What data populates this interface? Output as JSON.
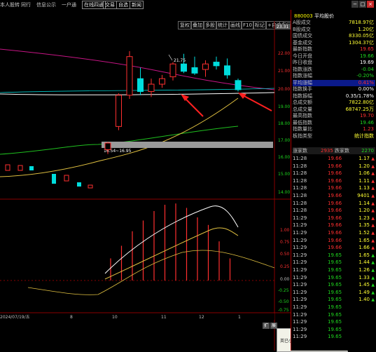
{
  "menu": {
    "items": [
      "本人股转",
      "同行",
      "信息公示",
      "一户通"
    ],
    "buttons": [
      "在线四通",
      "交易",
      "自选",
      "新闻"
    ]
  },
  "window_controls": [
    "−",
    "□",
    "×"
  ],
  "toolbar": {
    "buttons": [
      "复权",
      "叠加",
      "多股",
      "统计",
      "画线",
      "F10",
      "标记",
      "+自选",
      "返回"
    ]
  },
  "chart": {
    "ref_price_tag": "23.31",
    "high_marker": "21.75",
    "low_marker": "16.54~16.95",
    "price_axis": [
      "22.00",
      "21.00",
      "20.00",
      "19.00",
      "18.00",
      "17.00",
      "16.00",
      "15.00",
      "14.00"
    ],
    "indicator_axis": [
      "1.00",
      "0.75",
      "0.50",
      "0.25",
      "0.00",
      "-0.25",
      "-0.50",
      "-0.75"
    ],
    "date_label": "2024/07/19/五",
    "x_labels": [
      "8",
      "10",
      "11",
      "12",
      "1"
    ],
    "bottom_tabs": [
      "扩",
      "展"
    ],
    "popup_text": "英已小股都在转移：个半都转了"
  },
  "chart_data": {
    "type": "candlestick",
    "candles": [
      {
        "o": 16.54,
        "h": 16.95,
        "l": 16.3,
        "c": 16.9,
        "up": true
      },
      {
        "o": 17.8,
        "h": 19.6,
        "l": 17.6,
        "c": 19.5,
        "up": true
      },
      {
        "o": 19.5,
        "h": 21.9,
        "l": 19.3,
        "c": 21.6,
        "up": true
      },
      {
        "o": 20.4,
        "h": 21.0,
        "l": 19.5,
        "c": 19.7,
        "up": false
      },
      {
        "o": 19.7,
        "h": 20.4,
        "l": 19.4,
        "c": 20.1,
        "up": true
      },
      {
        "o": 20.1,
        "h": 20.6,
        "l": 19.9,
        "c": 20.4,
        "up": true
      },
      {
        "o": 20.5,
        "h": 21.3,
        "l": 20.3,
        "c": 21.2,
        "up": true
      },
      {
        "o": 21.2,
        "h": 21.75,
        "l": 20.7,
        "c": 20.8,
        "up": false
      },
      {
        "o": 21.0,
        "h": 21.6,
        "l": 20.6,
        "c": 20.7,
        "up": false
      },
      {
        "o": 20.9,
        "h": 21.4,
        "l": 20.5,
        "c": 21.2,
        "up": true
      },
      {
        "o": 21.3,
        "h": 21.6,
        "l": 20.9,
        "c": 21.1,
        "up": false
      },
      {
        "o": 21.1,
        "h": 21.5,
        "l": 20.4,
        "c": 20.6,
        "up": false
      },
      {
        "o": 20.3,
        "h": 20.4,
        "l": 19.7,
        "c": 19.8,
        "up": false
      }
    ],
    "histogram": [
      0.35,
      0.55,
      0.78,
      0.95,
      1.1,
      1.2,
      1.22,
      1.15,
      1.0,
      0.88,
      0.62,
      0.35
    ],
    "ylim": [
      14,
      23
    ],
    "indicator_ylim": [
      -0.75,
      1.25
    ]
  },
  "quote": {
    "code": "880003",
    "name": "平均股价",
    "rows": [
      {
        "label": "A股成交",
        "value": "7818.97亿",
        "color": "#ffff33"
      },
      {
        "label": "B股成交",
        "value": "1.20亿",
        "color": "#ffff33"
      },
      {
        "label": "国债成交",
        "value": "8330.05亿",
        "color": "#ffff33"
      },
      {
        "label": "基金成交",
        "value": "1304.37亿",
        "color": "#ffff33"
      },
      {
        "label": "最新指数",
        "value": "19.65",
        "color": "#ff3030"
      },
      {
        "label": "今日开盘",
        "value": "19.66",
        "color": "#1fd81f"
      },
      {
        "label": "昨日收盘",
        "value": "19.69",
        "color": "#ffffff"
      },
      {
        "label": "指数涨跌",
        "value": "-0.04",
        "color": "#1fd81f"
      },
      {
        "label": "指数涨幅",
        "value": "-0.20%",
        "color": "#1fd81f"
      },
      {
        "label": "平均涨幅",
        "value": "0.41%",
        "color": "#ff3030"
      },
      {
        "label": "指数换手",
        "value": "0.00%",
        "color": "#ffffff"
      },
      {
        "label": "指数振幅",
        "value": "0.35/1.78%",
        "color": "#ffffff"
      },
      {
        "label": "总成交额",
        "value": "7822.80亿",
        "color": "#ffff33"
      },
      {
        "label": "总成交量",
        "value": "68747.25万",
        "color": "#ffff33"
      },
      {
        "label": "最高指数",
        "value": "19.70",
        "color": "#ff3030"
      },
      {
        "label": "最低指数",
        "value": "19.46",
        "color": "#1fd81f"
      },
      {
        "label": "指数量比",
        "value": "1.23",
        "color": "#ff3030"
      },
      {
        "label": "板指类型",
        "value": "统计指数",
        "color": "#ffff33"
      }
    ],
    "updown": {
      "up_label": "涨家数",
      "up_value": "2935",
      "down_label": "跌家数",
      "down_value": "2270"
    },
    "ticks": [
      {
        "t": "11:28",
        "p": "19.66",
        "v": "1.17",
        "c": "#ff3030"
      },
      {
        "t": "11:28",
        "p": "19.66",
        "v": "1.20",
        "c": "#ff3030"
      },
      {
        "t": "11:28",
        "p": "19.66",
        "v": "1.06",
        "c": "#ff3030"
      },
      {
        "t": "11:28",
        "p": "19.66",
        "v": "1.11",
        "c": "#ff3030"
      },
      {
        "t": "11:28",
        "p": "19.66",
        "v": "1.13",
        "c": "#ff3030"
      },
      {
        "t": "11:28",
        "p": "19.66",
        "v": "9401",
        "c": "#ff3030"
      },
      {
        "t": "11:28",
        "p": "19.66",
        "v": "1.14",
        "c": "#ff3030"
      },
      {
        "t": "11:28",
        "p": "19.66",
        "v": "1.20",
        "c": "#ff3030"
      },
      {
        "t": "11:29",
        "p": "19.66",
        "v": "1.23",
        "c": "#ff3030"
      },
      {
        "t": "11:29",
        "p": "19.66",
        "v": "1.35",
        "c": "#ff3030"
      },
      {
        "t": "11:29",
        "p": "19.66",
        "v": "1.52",
        "c": "#ff3030"
      },
      {
        "t": "11:29",
        "p": "19.66",
        "v": "1.65",
        "c": "#ff3030"
      },
      {
        "t": "11:29",
        "p": "19.66",
        "v": "1.66",
        "c": "#ff3030"
      },
      {
        "t": "11:29",
        "p": "19.65",
        "v": "1.65",
        "c": "#1fd81f"
      },
      {
        "t": "11:29",
        "p": "19.65",
        "v": "1.44",
        "c": "#1fd81f"
      },
      {
        "t": "11:29",
        "p": "19.65",
        "v": "1.26",
        "c": "#1fd81f"
      },
      {
        "t": "11:29",
        "p": "19.65",
        "v": "1.33",
        "c": "#1fd81f"
      },
      {
        "t": "11:29",
        "p": "19.65",
        "v": "1.45",
        "c": "#1fd81f"
      },
      {
        "t": "11:29",
        "p": "19.65",
        "v": "1.49",
        "c": "#1fd81f"
      },
      {
        "t": "11:29",
        "p": "19.65",
        "v": "1.40",
        "c": "#1fd81f"
      },
      {
        "t": "11:29",
        "p": "19.65",
        "v": "",
        "c": "#1fd81f"
      },
      {
        "t": "11:29",
        "p": "19.65",
        "v": "",
        "c": "#1fd81f"
      },
      {
        "t": "11:29",
        "p": "19.65",
        "v": "",
        "c": "#1fd81f"
      },
      {
        "t": "11:29",
        "p": "19.65",
        "v": "",
        "c": "#1fd81f"
      },
      {
        "t": "11:29",
        "p": "19.65",
        "v": "",
        "c": "#1fd81f"
      }
    ]
  }
}
